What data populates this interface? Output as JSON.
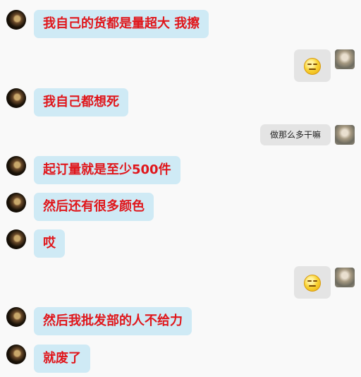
{
  "messages": [
    {
      "side": "in",
      "text": "我自己的货都是量超大 我擦"
    },
    {
      "side": "out",
      "emoji": "sneer-face-icon"
    },
    {
      "side": "in",
      "text": "我自己都想死"
    },
    {
      "side": "out",
      "text": "做那么多干嘛"
    },
    {
      "side": "in",
      "text": "起订量就是至少500件"
    },
    {
      "side": "in",
      "text": "然后还有很多颜色"
    },
    {
      "side": "in",
      "text": "哎"
    },
    {
      "side": "out",
      "emoji": "squint-smile-face-icon"
    },
    {
      "side": "in",
      "text": "然后我批发部的人不给力"
    },
    {
      "side": "in",
      "text": "就废了"
    }
  ],
  "colors": {
    "incoming_bubble": "#cfeaf5",
    "incoming_text": "#e0161b",
    "outgoing_bubble": "#e4e4e4",
    "background": "#f9f9f9"
  }
}
